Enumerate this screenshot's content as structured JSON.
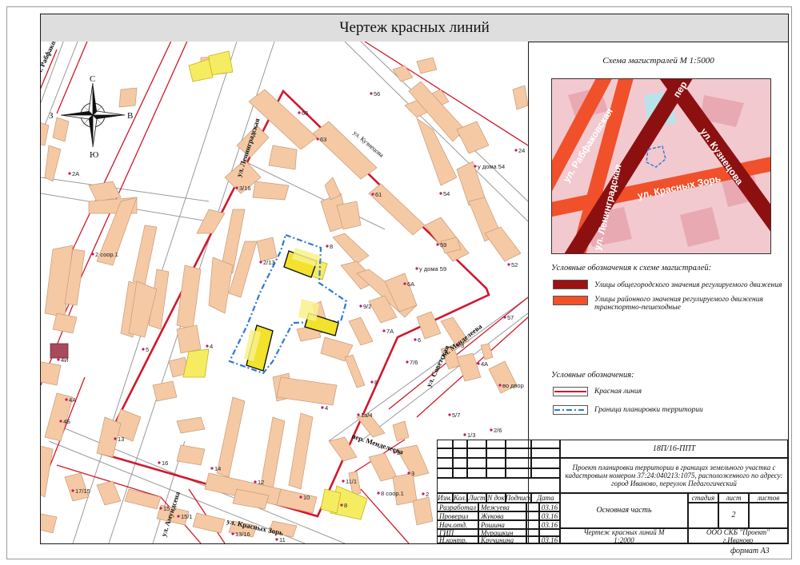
{
  "title": "Чертеж красных линий",
  "compass": {
    "n": "С",
    "s": "Ю",
    "w": "З",
    "e": "В"
  },
  "map_labels": {
    "street_leningradskaya": "ул. Ленинградская",
    "street_kuznetsova": "ул. Кузнецова",
    "street_krasnykh_zor": "ул. Красных Зорь",
    "street_sovetskaya": "ул. Советская",
    "street_mendeleeva": "ул. Менделеева",
    "per_mendeleeva": "пер. Менделеева",
    "street_rabfakovskaya": "ул. Рабфако...",
    "street_amundsen": "ул. Амундсена",
    "house_numbers": [
      {
        "id": "h56",
        "text": "56"
      },
      {
        "id": "h65",
        "text": "65"
      },
      {
        "id": "h63",
        "text": "63"
      },
      {
        "id": "h316",
        "text": "3/16"
      },
      {
        "id": "h61",
        "text": "61"
      },
      {
        "id": "h2a",
        "text": "2А"
      },
      {
        "id": "hu54",
        "text": "у дома 54"
      },
      {
        "id": "h54",
        "text": "54"
      },
      {
        "id": "h24",
        "text": "24"
      },
      {
        "id": "h2s",
        "text": "2 соор.1"
      },
      {
        "id": "h8a",
        "text": "8"
      },
      {
        "id": "h59",
        "text": "59"
      },
      {
        "id": "hu59",
        "text": "у дома 59"
      },
      {
        "id": "h52",
        "text": "52"
      },
      {
        "id": "h213",
        "text": "2/13"
      },
      {
        "id": "h6a",
        "text": "6А"
      },
      {
        "id": "h92",
        "text": "9/2"
      },
      {
        "id": "h57",
        "text": "57"
      },
      {
        "id": "h5",
        "text": "5"
      },
      {
        "id": "h4a",
        "text": "4"
      },
      {
        "id": "h7a",
        "text": "7А"
      },
      {
        "id": "h6",
        "text": "6"
      },
      {
        "id": "h3",
        "text": "3"
      },
      {
        "id": "h4i",
        "text": "4И"
      },
      {
        "id": "h7",
        "text": "7/6"
      },
      {
        "id": "h4a2",
        "text": "4А"
      },
      {
        "id": "h8",
        "text": "8"
      },
      {
        "id": "h4",
        "text": "4"
      },
      {
        "id": "hvo",
        "text": "во двор"
      },
      {
        "id": "h4g",
        "text": "4А"
      },
      {
        "id": "h4b",
        "text": "4Б"
      },
      {
        "id": "h14",
        "text": "1а/4"
      },
      {
        "id": "h57b",
        "text": "5/7"
      },
      {
        "id": "h13",
        "text": "13"
      },
      {
        "id": "h26",
        "text": "2/6"
      },
      {
        "id": "h13b",
        "text": "1/3"
      },
      {
        "id": "h16",
        "text": "16"
      },
      {
        "id": "h14b",
        "text": "14"
      },
      {
        "id": "h12",
        "text": "12"
      },
      {
        "id": "h10",
        "text": "10"
      },
      {
        "id": "h2",
        "text": "2"
      },
      {
        "id": "h111",
        "text": "11/1"
      },
      {
        "id": "h8s",
        "text": "8 соор.1"
      },
      {
        "id": "h1715",
        "text": "17/15"
      },
      {
        "id": "h15",
        "text": "15"
      },
      {
        "id": "h151",
        "text": "15/1"
      },
      {
        "id": "h1316",
        "text": "13/16"
      },
      {
        "id": "h11",
        "text": "11"
      },
      {
        "id": "h8b",
        "text": "8"
      },
      {
        "id": "h3b",
        "text": "3"
      },
      {
        "id": "h2b",
        "text": "2"
      }
    ]
  },
  "schema": {
    "title": "Схема магистралей М 1:5000",
    "streets": {
      "rabfakovskaya": "ул. Рабфаковская",
      "leningradskaya": "ул. Ленинградская",
      "kuznetsova": "ул. Кузнецова",
      "krasnykh_zor": "ул. Красных Зорь",
      "per": "пер"
    }
  },
  "legend": {
    "schema_heading": "Условные обозначения к схеме магистралей:",
    "items_schema": [
      {
        "color": "#9c1111",
        "label": "Улицы общегородского значения регулируемого движения"
      },
      {
        "color": "#f0502a",
        "label": "Улицы районного значения регулируемого движения транспортно-пешеходные"
      }
    ],
    "heading": "Условные обозначения:",
    "items": [
      {
        "color": "#cc1a2e",
        "label": "Красная линия"
      },
      {
        "color": "#2f78d8",
        "label": "Граница планировки территории"
      }
    ]
  },
  "stamp": {
    "code": "18П/16-ППТ",
    "project": "Проект планировки территории в границах земельного участка с кадастровым номером 37:24:040213:1075, расположенного по адресу: город Иваново, переулок Педагогический",
    "headers": [
      "Изм.",
      "Кол.",
      "Лист",
      "N док",
      "Подпись",
      "Дата"
    ],
    "rows": [
      {
        "role": "Разработал",
        "name": "Межуева",
        "date": "03.16"
      },
      {
        "role": "Проверил",
        "name": "Жукова",
        "date": "03.16"
      },
      {
        "role": "Нач.отд.",
        "name": "Рошина",
        "date": "03.16"
      },
      {
        "role": "ГИП",
        "name": "Мурашкин",
        "date": ""
      },
      {
        "role": "",
        "name": "",
        "date": ""
      },
      {
        "role": "Н.контр.",
        "name": "Кручинина",
        "date": "03.16"
      }
    ],
    "part": "Основная часть",
    "stage_label": "стадия",
    "sheet_label": "лист",
    "sheets_label": "листов",
    "stage": "",
    "sheet": "2",
    "sheets": "",
    "drawing_title": "Чертеж красных линий М 1:2000",
    "org": "ООО СКБ \"Проект\" г.Иваново"
  },
  "format": "формат А3"
}
